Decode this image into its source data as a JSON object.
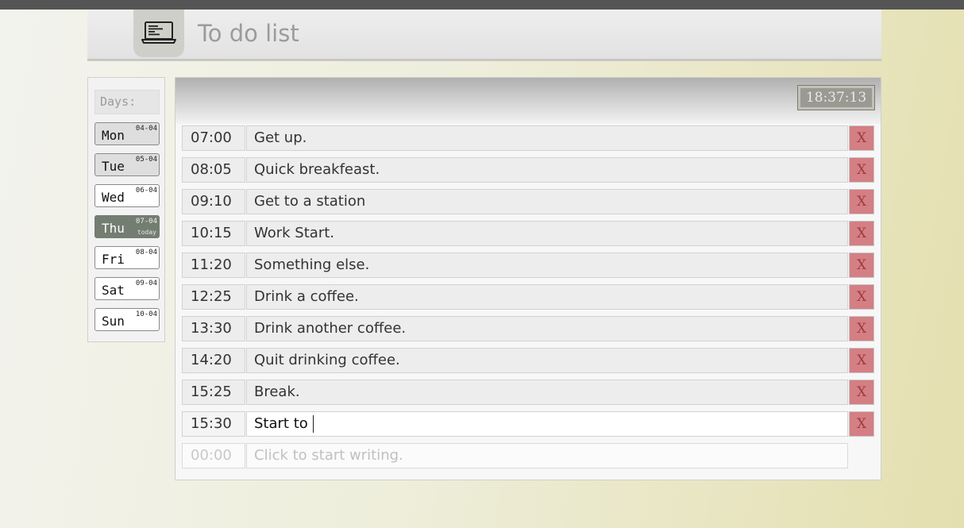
{
  "header": {
    "title": "To do list",
    "logo_icon": "laptop-icon"
  },
  "days": {
    "label": "Days:",
    "items": [
      {
        "name": "Mon",
        "date": "04-04",
        "today_label": "",
        "state": "grey"
      },
      {
        "name": "Tue",
        "date": "05-04",
        "today_label": "",
        "state": "grey"
      },
      {
        "name": "Wed",
        "date": "06-04",
        "today_label": "",
        "state": "white"
      },
      {
        "name": "Thu",
        "date": "07-04",
        "today_label": "today",
        "state": "active"
      },
      {
        "name": "Fri",
        "date": "08-04",
        "today_label": "",
        "state": "white"
      },
      {
        "name": "Sat",
        "date": "09-04",
        "today_label": "",
        "state": "white"
      },
      {
        "name": "Sun",
        "date": "10-04",
        "today_label": "",
        "state": "white"
      }
    ]
  },
  "clock": "18:37:13",
  "tasks": [
    {
      "time": "07:00",
      "text": "Get up.",
      "delete_label": "X"
    },
    {
      "time": "08:05",
      "text": "Quick breakfeast.",
      "delete_label": "X"
    },
    {
      "time": "09:10",
      "text": "Get to a station",
      "delete_label": "X"
    },
    {
      "time": "10:15",
      "text": "Work Start.",
      "delete_label": "X"
    },
    {
      "time": "11:20",
      "text": "Something else.",
      "delete_label": "X"
    },
    {
      "time": "12:25",
      "text": "Drink a coffee.",
      "delete_label": "X"
    },
    {
      "time": "13:30",
      "text": "Drink another coffee.",
      "delete_label": "X"
    },
    {
      "time": "14:20",
      "text": "Quit drinking coffee.",
      "delete_label": "X"
    },
    {
      "time": "15:25",
      "text": "Break.",
      "delete_label": "X"
    },
    {
      "time": "15:30",
      "text": "Start to",
      "delete_label": "X"
    }
  ],
  "new_task": {
    "time_placeholder": "00:00",
    "text_placeholder": "Click to start writing."
  }
}
